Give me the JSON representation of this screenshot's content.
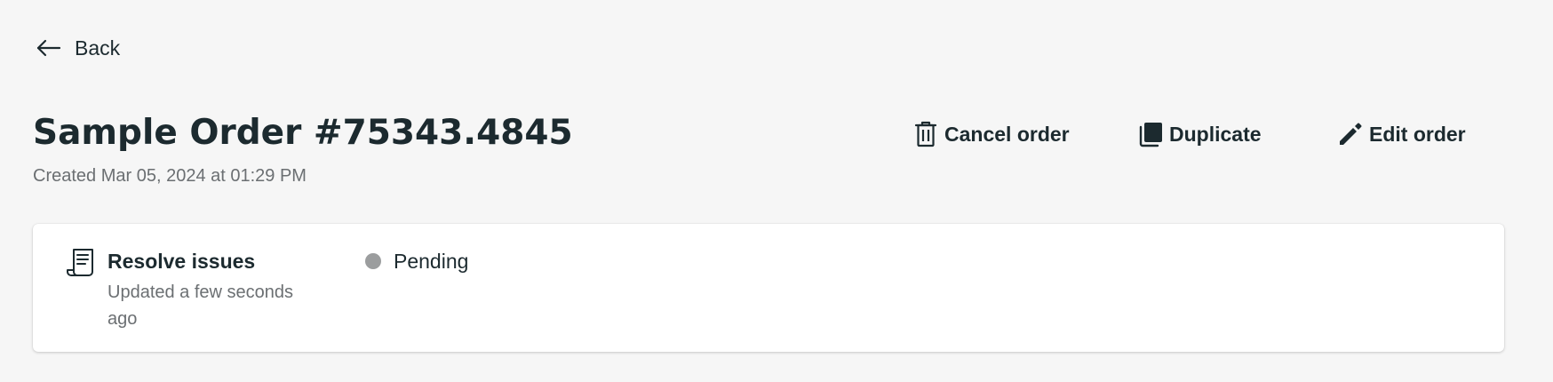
{
  "navigation": {
    "back_label": "Back",
    "back_icon": "arrow-left-icon"
  },
  "order": {
    "title": "Sample Order #75343.4845",
    "created": "Created Mar 05, 2024 at 01:29 PM"
  },
  "actions": {
    "cancel_label": "Cancel order",
    "cancel_icon": "trash-icon",
    "duplicate_label": "Duplicate",
    "duplicate_icon": "copy-icon",
    "edit_label": "Edit order",
    "edit_icon": "pencil-icon"
  },
  "status_card": {
    "icon": "receipt-icon",
    "title": "Resolve issues",
    "updated": "Updated a few seconds ago",
    "status_label": "Pending",
    "status_color": "#9b9d9e"
  },
  "colors": {
    "background": "#f6f6f6",
    "text": "#1c2a2f",
    "muted": "#6b6f72",
    "card": "#ffffff"
  }
}
